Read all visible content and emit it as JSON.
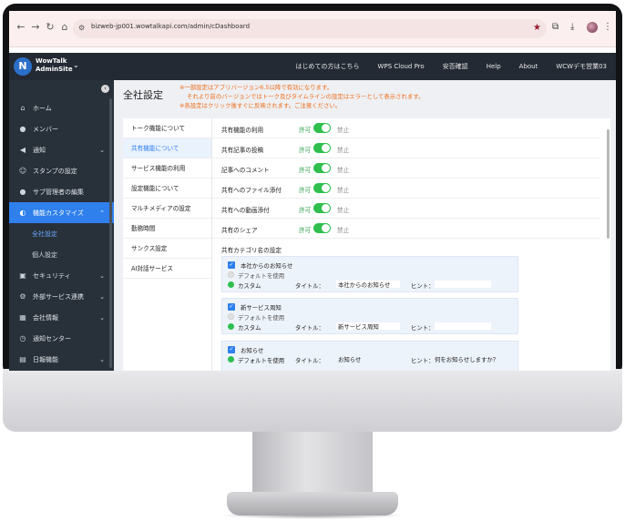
{
  "browser": {
    "url": "bizweb-jp001.wowtalkapi.com/admin/cDashboard"
  },
  "header": {
    "logo_letter": "N",
    "logo_line1": "WowTalk",
    "logo_line2": "AdminSite",
    "links": [
      "はじめての方はこちら",
      "WPS Cloud Pro",
      "安否確認",
      "Help",
      "About",
      "WCWデモ営業03"
    ]
  },
  "sidebar": {
    "items": [
      {
        "label": "ホーム",
        "icon": "home-icon"
      },
      {
        "label": "メンバー",
        "icon": "person-icon"
      },
      {
        "label": "通知",
        "icon": "megaphone-icon"
      },
      {
        "label": "スタンプの設定",
        "icon": "smile-icon"
      },
      {
        "label": "サブ管理者の編集",
        "icon": "admin-icon"
      },
      {
        "label": "機能カスタマイズ",
        "icon": "toggle-icon"
      },
      {
        "label": "全社設定",
        "icon": ""
      },
      {
        "label": "個人設定",
        "icon": ""
      },
      {
        "label": "セキュリティ",
        "icon": "lock-icon"
      },
      {
        "label": "外部サービス連携",
        "icon": "gear-icon"
      },
      {
        "label": "会社情報",
        "icon": "building-icon"
      },
      {
        "label": "通知センター",
        "icon": "clock-icon"
      },
      {
        "label": "日報機能",
        "icon": "report-icon"
      }
    ]
  },
  "page": {
    "title": "全社設定",
    "notice": [
      "※一部設定はアプリバージョン6.5以降で有効になります。",
      "それより前のバージョンではトーク及びタイムラインの設定はエラーとして表示されます。",
      "※各設定はクリック後すぐに反映されます。ご注意ください。"
    ]
  },
  "sub_nav": {
    "items": [
      "トーク機能について",
      "共有機能について",
      "サービス機能の利用",
      "設定機能について",
      "マルチメディアの設定",
      "勤務時間",
      "サンクス設定",
      "AI対話サービス"
    ]
  },
  "settings": {
    "allow_label": "許可",
    "deny_label": "禁止",
    "rows": [
      "共有機能の利用",
      "共有記事の投稿",
      "記事へのコメント",
      "共有へのファイル添付",
      "共有への動画添付",
      "共有のシェア"
    ],
    "category_title": "共有カテゴリ名の設定",
    "categories": [
      {
        "name": "本社からのお知らせ",
        "default_option": "デフォルトを使用",
        "custom_option": "カスタム",
        "title_label": "タイトル：",
        "title_value": "本社からのお知らせ",
        "hint_label": "ヒント：",
        "hint_value": ""
      },
      {
        "name": "新サービス周知",
        "default_option": "デフォルトを使用",
        "custom_option": "カスタム",
        "title_label": "タイトル：",
        "title_value": "新サービス周知",
        "hint_label": "ヒント：",
        "hint_value": ""
      },
      {
        "name": "お知らせ",
        "default_option": "デフォルトを使用",
        "title_label": "タイトル：",
        "title_value": "お知らせ",
        "hint_label": "ヒント：",
        "hint_value": "何をお知らせしますか？"
      }
    ]
  },
  "colors": {
    "accent": "#2f80ed",
    "toggle_on": "#2fbf4f",
    "notice": "#ef6c1a",
    "sidebar_bg": "#283039",
    "header_bg": "#232a34"
  }
}
